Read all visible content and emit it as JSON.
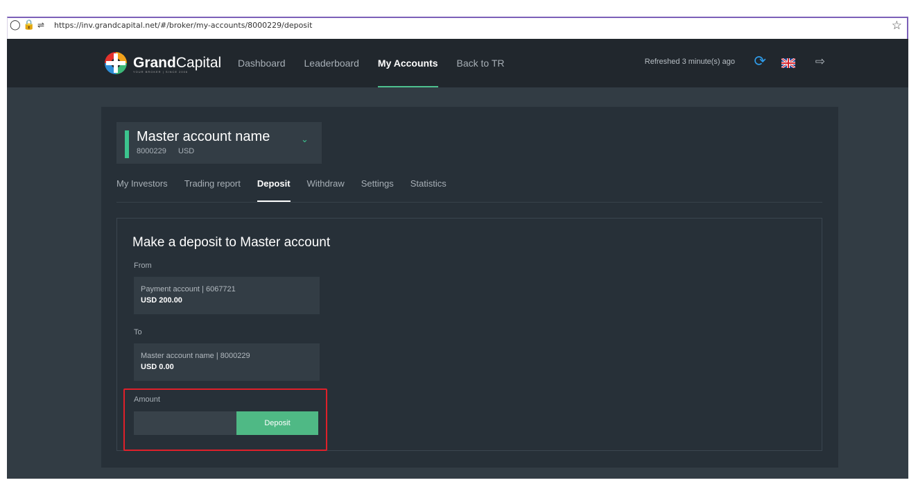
{
  "browser": {
    "url": "https://inv.grandcapital.net/#/broker/my-accounts/8000229/deposit",
    "icons": [
      "shield-icon",
      "lock-icon",
      "permissions-icon",
      "bookmark-star-icon"
    ]
  },
  "header": {
    "logo_bold": "Grand",
    "logo_light": "Capital",
    "logo_sub": "YOUR BROKER | SINCE 2006",
    "nav": [
      {
        "label": "Dashboard",
        "active": false
      },
      {
        "label": "Leaderboard",
        "active": false
      },
      {
        "label": "My Accounts",
        "active": true
      },
      {
        "label": "Back to TR",
        "active": false
      }
    ],
    "refreshed": "Refreshed 3 minute(s) ago",
    "icons": [
      "refresh-icon",
      "uk-flag-icon",
      "logout-icon"
    ]
  },
  "account": {
    "name": "Master account name",
    "number": "8000229",
    "currency": "USD"
  },
  "tabs": [
    {
      "label": "My Investors",
      "active": false
    },
    {
      "label": "Trading report",
      "active": false
    },
    {
      "label": "Deposit",
      "active": true
    },
    {
      "label": "Withdraw",
      "active": false
    },
    {
      "label": "Settings",
      "active": false
    },
    {
      "label": "Statistics",
      "active": false
    }
  ],
  "deposit": {
    "title": "Make a deposit to Master account",
    "from_label": "From",
    "from_account": "Payment account | 6067721",
    "from_balance": "USD 200.00",
    "to_label": "To",
    "to_account": "Master account name | 8000229",
    "to_balance": "USD 0.00",
    "amount_label": "Amount",
    "amount_value": "",
    "button": "Deposit"
  },
  "colors": {
    "accent": "#4fb985",
    "header_bg": "#21272d",
    "page_bg": "#323c44",
    "card_bg": "#273038",
    "highlight": "#e0202a"
  }
}
